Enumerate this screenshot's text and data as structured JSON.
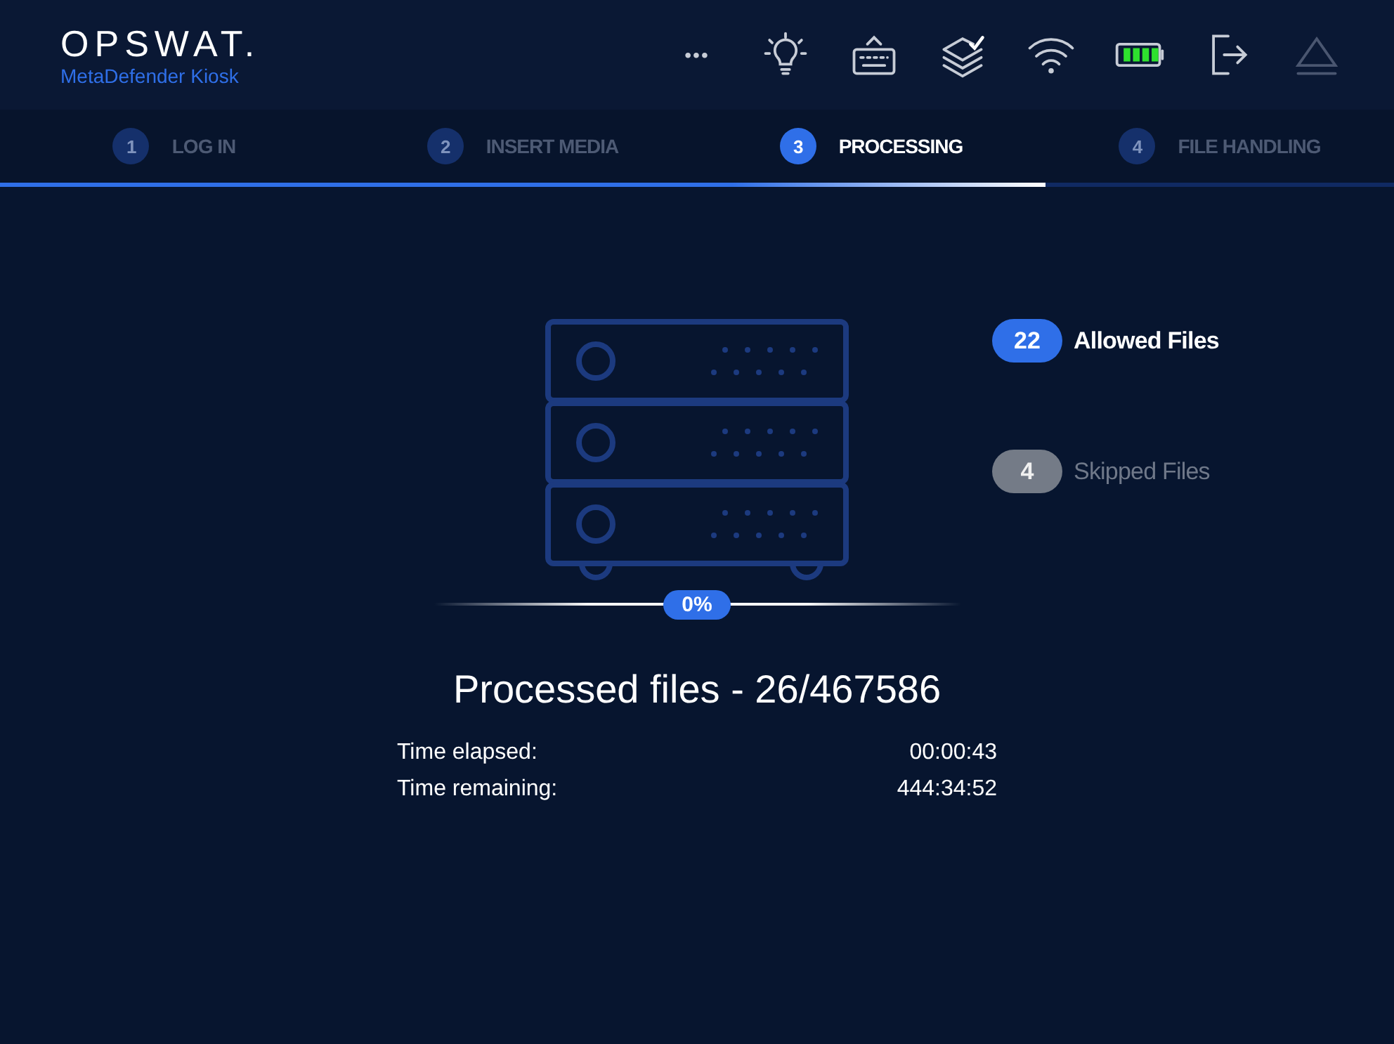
{
  "header": {
    "logo": "OPSWAT.",
    "product": "MetaDefender Kiosk"
  },
  "toolbar": [
    {
      "kind": "more",
      "label": "•••",
      "disabled": false
    },
    {
      "kind": "light",
      "disabled": false
    },
    {
      "kind": "keyboard",
      "disabled": false
    },
    {
      "kind": "layers",
      "disabled": false
    },
    {
      "kind": "wifi",
      "disabled": false
    },
    {
      "kind": "battery",
      "disabled": false
    },
    {
      "kind": "logout",
      "disabled": false
    },
    {
      "kind": "eject",
      "disabled": true
    }
  ],
  "steps": [
    {
      "number": "1",
      "label": "LOG IN",
      "selected": false
    },
    {
      "number": "2",
      "label": "INSERT MEDIA",
      "selected": false
    },
    {
      "number": "3",
      "label": "PROCESSING",
      "selected": true
    },
    {
      "number": "4",
      "label": "FILE HANDLING",
      "selected": false
    }
  ],
  "step_progress": {
    "level": 0.75
  },
  "counters": [
    {
      "kind": "allowed",
      "count": "22",
      "label": "Allowed Files"
    },
    {
      "kind": "skipped",
      "count": "4",
      "label": "Skipped Files"
    }
  ],
  "progress": {
    "reading": "0%"
  },
  "title": "Processed files - 26/467586",
  "times": [
    {
      "label": "Time elapsed:",
      "value": "00:00:43"
    },
    {
      "label": "Time remaining:",
      "value": "444:34:52"
    }
  ]
}
